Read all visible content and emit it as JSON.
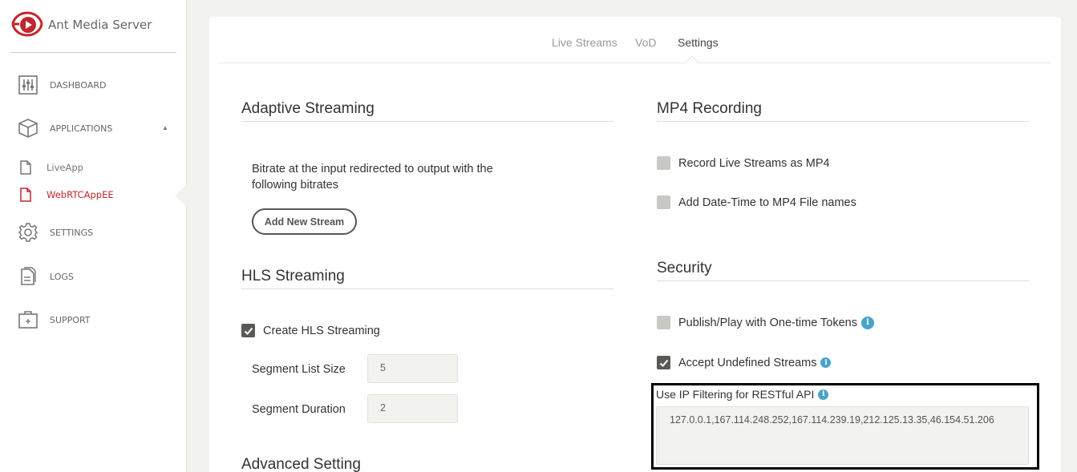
{
  "brand": {
    "name": "Ant Media Server",
    "logo_icon": "ant-media-logo-icon",
    "accent": "#c1272d"
  },
  "nav": {
    "dashboard": "DASHBOARD",
    "applications": "APPLICATIONS",
    "apps": [
      {
        "label": "LiveApp",
        "active": false
      },
      {
        "label": "WebRTCAppEE",
        "active": true
      }
    ],
    "settings": "SETTINGS",
    "logs": "LOGS",
    "support": "SUPPORT"
  },
  "tabs": [
    {
      "label": "Live Streams",
      "active": false
    },
    {
      "label": "VoD",
      "active": false
    },
    {
      "label": "Settings",
      "active": true
    }
  ],
  "adaptive": {
    "title": "Adaptive Streaming",
    "description": "Bitrate at the input redirected to output with the following bitrates",
    "add_button": "Add New Stream"
  },
  "hls": {
    "title": "HLS Streaming",
    "create_label": "Create HLS Streaming",
    "create_checked": true,
    "segment_list_label": "Segment List Size",
    "segment_list_value": "5",
    "segment_duration_label": "Segment Duration",
    "segment_duration_value": "2"
  },
  "advanced": {
    "title": "Advanced Setting"
  },
  "mp4": {
    "title": "MP4 Recording",
    "record_label": "Record Live Streams as MP4",
    "record_checked": false,
    "datetime_label": "Add Date-Time to MP4 File names",
    "datetime_checked": false
  },
  "security": {
    "title": "Security",
    "tokens_label": "Publish/Play with One-time Tokens",
    "tokens_checked": false,
    "undefined_label": "Accept Undefined Streams",
    "undefined_checked": true,
    "ip_filter_label": "Use IP Filtering for RESTful API",
    "ip_filter_value": "127.0.0.1,167.114.248.252,167.114.239.19,212.125.13.35,46.154.51.206"
  }
}
